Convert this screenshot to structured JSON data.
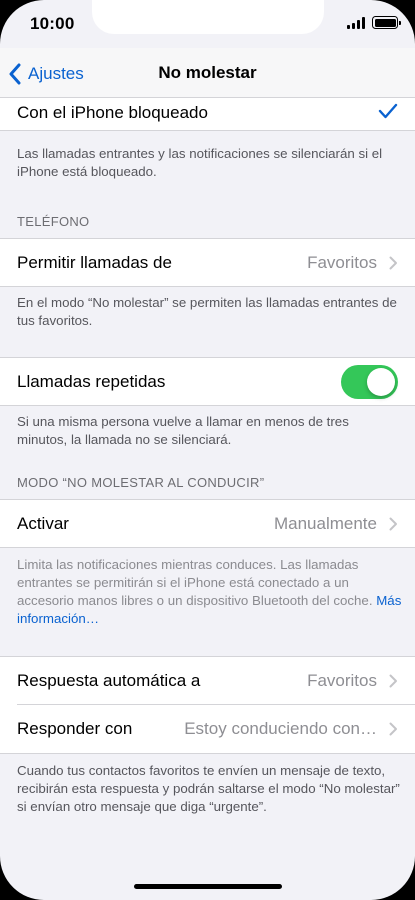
{
  "status_bar": {
    "time": "10:00"
  },
  "nav": {
    "back_label": "Ajustes",
    "title": "No molestar"
  },
  "locked_row": {
    "label": "Con el iPhone bloqueado"
  },
  "locked_footnote": "Las llamadas entrantes y las notificaciones se silenciarán si el iPhone está bloqueado.",
  "phone_section": {
    "header": "TELÉFONO",
    "allow_calls": {
      "label": "Permitir llamadas de",
      "value": "Favoritos"
    },
    "allow_footnote": "En el modo “No molestar” se permiten las llamadas entrantes de tus favoritos.",
    "repeated_calls": {
      "label": "Llamadas repetidas",
      "enabled": true
    },
    "repeated_footnote": "Si una misma persona vuelve a llamar en menos de tres minutos, la llamada no se silenciará."
  },
  "driving_section": {
    "header": "MODO “NO MOLESTAR AL CONDUCIR”",
    "activate": {
      "label": "Activar",
      "value": "Manualmente"
    },
    "activate_footnote": "Limita las notificaciones mientras conduces. Las llamadas entrantes se permitirán si el iPhone está conectado a un accesorio manos libres o un dispositivo Bluetooth del coche.",
    "more_info_link": "Más información…",
    "auto_reply": {
      "label": "Respuesta automática a",
      "value": "Favoritos"
    },
    "reply_with": {
      "label": "Responder con",
      "value": "Estoy conduciendo con…"
    },
    "reply_footnote": "Cuando tus contactos favoritos te envíen un mensaje de texto, recibirán esta respuesta y podrán saltarse el modo “No molestar” si envían otro mensaje que diga “urgente”."
  },
  "colors": {
    "accent": "#0a62d0",
    "toggle_on": "#34c759",
    "background": "#f2f2f7"
  }
}
